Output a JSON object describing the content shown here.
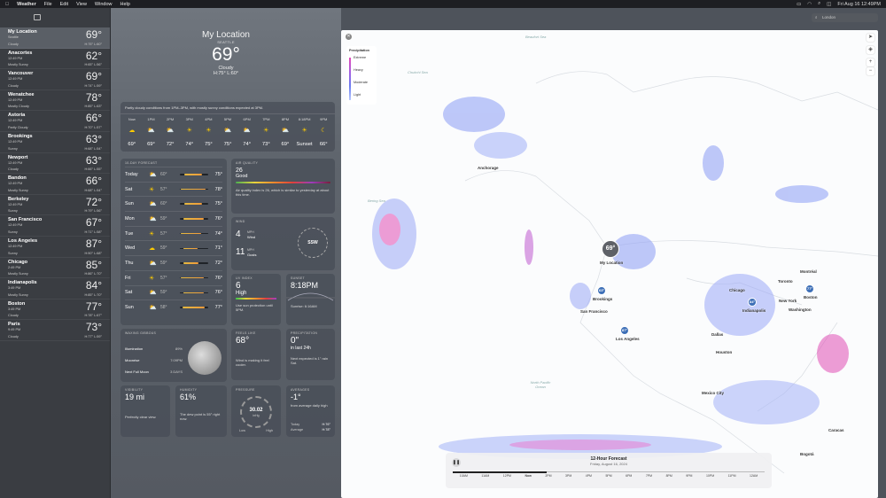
{
  "menubar": {
    "app": "Weather",
    "items": [
      "File",
      "Edit",
      "View",
      "Window",
      "Help"
    ],
    "clock": "Fri Aug 16  12:49PM"
  },
  "search": {
    "placeholder": "London"
  },
  "locations": [
    {
      "name": "My Location",
      "sub": "Seattle",
      "cond": "Cloudy",
      "temp": "69°",
      "hl": "H:75° L:60°"
    },
    {
      "name": "Anacortes",
      "sub": "12:49 PM",
      "cond": "Mostly Sunny",
      "temp": "62°",
      "hl": "H:65° L:56°"
    },
    {
      "name": "Vancouver",
      "sub": "12:49 PM",
      "cond": "Cloudy",
      "temp": "69°",
      "hl": "H:74° L:59°"
    },
    {
      "name": "Wenatchee",
      "sub": "12:49 PM",
      "cond": "Mostly Cloudy",
      "temp": "78°",
      "hl": "H:85° L:63°"
    },
    {
      "name": "Astoria",
      "sub": "12:49 PM",
      "cond": "Partly Cloudy",
      "temp": "66°",
      "hl": "H:70° L:57°"
    },
    {
      "name": "Brookings",
      "sub": "12:49 PM",
      "cond": "Sunny",
      "temp": "63°",
      "hl": "H:68° L:54°"
    },
    {
      "name": "Newport",
      "sub": "12:49 PM",
      "cond": "Cloudy",
      "temp": "63°",
      "hl": "H:66° L:55°"
    },
    {
      "name": "Bandon",
      "sub": "12:49 PM",
      "cond": "Mostly Sunny",
      "temp": "66°",
      "hl": "H:68° L:54°"
    },
    {
      "name": "Berkeley",
      "sub": "12:49 PM",
      "cond": "Sunny",
      "temp": "72°",
      "hl": "H:79° L:56°"
    },
    {
      "name": "San Francisco",
      "sub": "12:49 PM",
      "cond": "Sunny",
      "temp": "67°",
      "hl": "H:71° L:58°"
    },
    {
      "name": "Los Angeles",
      "sub": "12:49 PM",
      "cond": "Sunny",
      "temp": "87°",
      "hl": "H:90° L:68°"
    },
    {
      "name": "Chicago",
      "sub": "2:49 PM",
      "cond": "Mostly Sunny",
      "temp": "85°",
      "hl": "H:86° L:70°"
    },
    {
      "name": "Indianapolis",
      "sub": "3:49 PM",
      "cond": "Mostly Sunny",
      "temp": "84°",
      "hl": "H:85° L:70°"
    },
    {
      "name": "Boston",
      "sub": "3:49 PM",
      "cond": "Cloudy",
      "temp": "77°",
      "hl": "H:78° L:67°"
    },
    {
      "name": "Paris",
      "sub": "9:49 PM",
      "cond": "Cloudy",
      "temp": "73°",
      "hl": "H:77° L:59°"
    }
  ],
  "hero": {
    "city": "My Location",
    "sub": "SEATTLE",
    "temp": "69°",
    "cond": "Cloudy",
    "hl": "H:75° L:60°"
  },
  "hourly": {
    "summary": "Partly cloudy conditions from 1PM–3PM, with mostly sunny conditions expected at 3PM.",
    "hours": [
      {
        "t": "Now",
        "v": "69°"
      },
      {
        "t": "1PM",
        "v": "69°"
      },
      {
        "t": "2PM",
        "v": "72°"
      },
      {
        "t": "3PM",
        "v": "74°"
      },
      {
        "t": "4PM",
        "v": "75°"
      },
      {
        "t": "5PM",
        "v": "75°"
      },
      {
        "t": "6PM",
        "v": "74°"
      },
      {
        "t": "7PM",
        "v": "73°"
      },
      {
        "t": "8PM",
        "v": "69°"
      },
      {
        "t": "8:18PM",
        "v": "Sunset"
      },
      {
        "t": "9PM",
        "v": "66°"
      }
    ]
  },
  "ten": {
    "title": "10-DAY FORECAST",
    "days": [
      {
        "d": "Today",
        "lo": "60°",
        "hi": "75°"
      },
      {
        "d": "Sat",
        "lo": "57°",
        "hi": "78°"
      },
      {
        "d": "Sun",
        "lo": "60°",
        "hi": "75°"
      },
      {
        "d": "Mon",
        "lo": "59°",
        "hi": "76°"
      },
      {
        "d": "Tue",
        "lo": "57°",
        "hi": "74°"
      },
      {
        "d": "Wed",
        "lo": "59°",
        "hi": "71°"
      },
      {
        "d": "Thu",
        "lo": "59°",
        "hi": "72°"
      },
      {
        "d": "Fri",
        "lo": "57°",
        "hi": "76°"
      },
      {
        "d": "Sat",
        "lo": "59°",
        "hi": "76°"
      },
      {
        "d": "Sun",
        "lo": "58°",
        "hi": "77°"
      }
    ]
  },
  "air": {
    "title": "AIR QUALITY",
    "val": "26",
    "lvl": "Good",
    "desc": "Air quality index is 26, which is similar to yesterday at about this time."
  },
  "wind": {
    "title": "WIND",
    "v1": "4",
    "u1": "MPH",
    "l1": "Wind",
    "v2": "11",
    "u2": "MPH",
    "l2": "Gusts",
    "dir": "SSW"
  },
  "uv": {
    "title": "UV INDEX",
    "val": "6",
    "lvl": "High",
    "desc": "Use sun protection until 5PM."
  },
  "sunset": {
    "title": "SUNSET",
    "val": "8:18PM",
    "sub": "Sunrise: 6:16AM"
  },
  "moon": {
    "title": "WAXING GIBBOUS",
    "r1": "Illumination",
    "r1v": "89%",
    "r2": "Moonrise",
    "r2v": "7:09PM",
    "r3": "Next Full Moon",
    "r3v": "3 DAYS"
  },
  "feels": {
    "title": "FEELS LIKE",
    "val": "68°",
    "desc": "Wind is making it feel cooler."
  },
  "precip": {
    "title": "PRECIPITATION",
    "val": "0\"",
    "sub": "in last 24h",
    "desc": "Next expected is 1\" rain Sat."
  },
  "vis": {
    "title": "VISIBILITY",
    "val": "19 mi",
    "desc": "Perfectly clear view."
  },
  "hum": {
    "title": "HUMIDITY",
    "val": "61%",
    "desc": "The dew point is 55° right now."
  },
  "press": {
    "title": "PRESSURE",
    "val": "30.02",
    "u": "inHg",
    "lo": "Low",
    "hi": "High"
  },
  "avg": {
    "title": "AVERAGES",
    "val": "-1°",
    "desc": "from average daily high",
    "r1": "Today",
    "r1v": "H:76°",
    "r2": "Average",
    "r2v": "H:78°"
  },
  "map": {
    "legend": {
      "title": "Precipitation",
      "levels": [
        "Extreme",
        "Heavy",
        "Moderate",
        "Light"
      ]
    },
    "labels": [
      "Anchorage",
      "San Francisco",
      "Los Angeles",
      "Chicago",
      "Toronto",
      "Montréal",
      "New York",
      "Boston",
      "Washington",
      "Indianapolis",
      "Dallas",
      "Houston",
      "Mexico City",
      "Caracas",
      "Bogotá",
      "North Pacific Ocean",
      "My Location",
      "Beaufort Sea",
      "Chukchi Sea",
      "Bering Sea",
      "Brookings"
    ],
    "timeline": {
      "title": "12-Hour Forecast",
      "date": "Friday, August 16, 2024",
      "ticks": [
        "10AM",
        "11AM",
        "12PM",
        "Now",
        "2PM",
        "3PM",
        "4PM",
        "5PM",
        "6PM",
        "7PM",
        "8PM",
        "9PM",
        "10PM",
        "11PM",
        "12AM"
      ]
    }
  }
}
